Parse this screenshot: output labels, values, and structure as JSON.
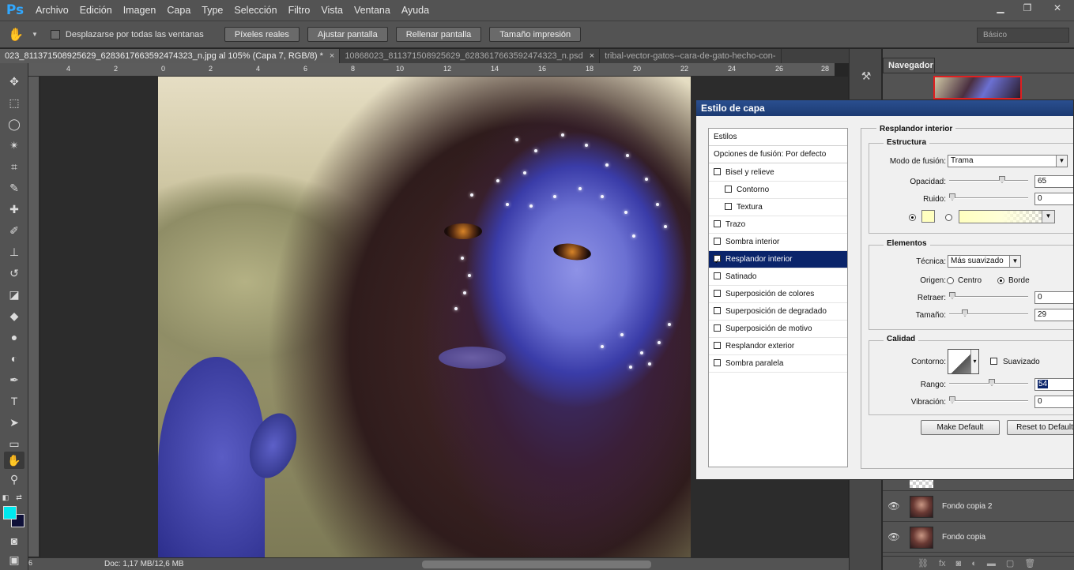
{
  "app": {
    "logo": "Ps"
  },
  "menu": [
    "Archivo",
    "Edición",
    "Imagen",
    "Capa",
    "Type",
    "Selección",
    "Filtro",
    "Vista",
    "Ventana",
    "Ayuda"
  ],
  "window": {
    "minimize": "▁",
    "restore": "❐",
    "close": "✕"
  },
  "options": {
    "scroll_all_label": "Desplazarse por todas las ventanas",
    "buttons": [
      "Píxeles reales",
      "Ajustar pantalla",
      "Rellenar pantalla",
      "Tamaño impresión"
    ],
    "workspace": "Básico"
  },
  "tabs": [
    {
      "label": "023_811371508925629_6283617663592474323_n.jpg al 105% (Capa 7, RGB/8) *",
      "close": "×"
    },
    {
      "label": "10868023_811371508925629_6283617663592474323_n.psd",
      "close": "×"
    },
    {
      "label": "tribal-vector-gatos--cara-de-gato-hecho-con-",
      "close": ""
    }
  ],
  "ruler_ticks": [
    "4",
    "2",
    "0",
    "2",
    "4",
    "6",
    "8",
    "10",
    "12",
    "14",
    "16",
    "18",
    "20",
    "22",
    "24",
    "26",
    "28"
  ],
  "status": {
    "zoom": "6",
    "doc": "Doc: 1,17 MB/12,6 MB"
  },
  "navigator": {
    "title": "Navegador"
  },
  "layers": [
    {
      "name": "Fondo copia 2"
    },
    {
      "name": "Fondo copia"
    }
  ],
  "dialog": {
    "title": "Estilo de capa",
    "styles_header": "Estilos",
    "blend_options": "Opciones de fusión: Por defecto",
    "styles": [
      {
        "label": "Bisel y relieve",
        "checked": false,
        "indent": false
      },
      {
        "label": "Contorno",
        "checked": false,
        "indent": true
      },
      {
        "label": "Textura",
        "checked": false,
        "indent": true
      },
      {
        "label": "Trazo",
        "checked": false,
        "indent": false
      },
      {
        "label": "Sombra interior",
        "checked": false,
        "indent": false
      },
      {
        "label": "Resplandor interior",
        "checked": true,
        "indent": false,
        "selected": true
      },
      {
        "label": "Satinado",
        "checked": false,
        "indent": false
      },
      {
        "label": "Superposición de colores",
        "checked": false,
        "indent": false
      },
      {
        "label": "Superposición de degradado",
        "checked": false,
        "indent": false
      },
      {
        "label": "Superposición de motivo",
        "checked": false,
        "indent": false
      },
      {
        "label": "Resplandor exterior",
        "checked": false,
        "indent": false
      },
      {
        "label": "Sombra paralela",
        "checked": false,
        "indent": false
      }
    ],
    "section_title": "Resplandor interior",
    "estructura": {
      "legend": "Estructura",
      "blend_mode_label": "Modo de fusión:",
      "blend_mode_value": "Trama",
      "opacity_label": "Opacidad:",
      "opacity_value": "65",
      "noise_label": "Ruido:",
      "noise_value": "0",
      "glow_color": "#ffffc0"
    },
    "elementos": {
      "legend": "Elementos",
      "technique_label": "Técnica:",
      "technique_value": "Más suavizado",
      "source_label": "Origen:",
      "source_center": "Centro",
      "source_edge": "Borde",
      "choke_label": "Retraer:",
      "choke_value": "0",
      "size_label": "Tamaño:",
      "size_value": "29"
    },
    "calidad": {
      "legend": "Calidad",
      "contour_label": "Contorno:",
      "antialias_label": "Suavizado",
      "range_label": "Rango:",
      "range_value": "54",
      "jitter_label": "Vibración:",
      "jitter_value": "0"
    },
    "make_default": "Make Default",
    "reset_default": "Reset to Default"
  },
  "colors": {
    "foreground": "#00e8ef",
    "background": "#0e1038",
    "selection": "#0a246a"
  }
}
